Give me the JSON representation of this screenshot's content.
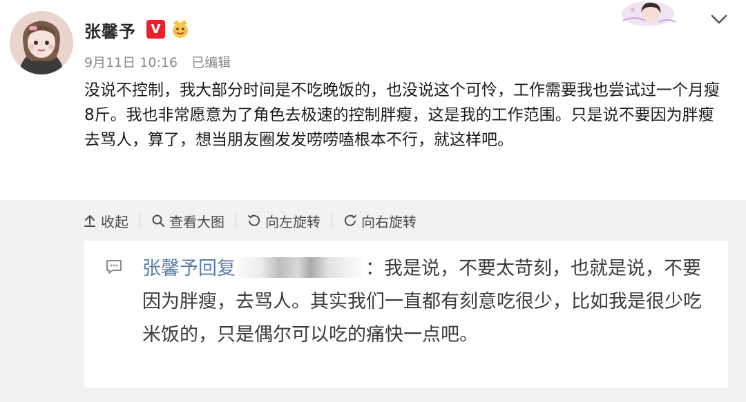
{
  "post": {
    "username": "张馨予",
    "badge_v": "V",
    "date": "9月11日 10:16",
    "edited": "已编辑",
    "content": "没说不控制，我大部分时间是不吃晚饭的，也没说这个可怜，工作需要我也尝试过一个月瘦8斤。我也非常愿意为了角色去极速的控制胖瘦，这是我的工作范围。只是说不要因为胖瘦去骂人，算了，想当朋友圈发发唠唠嗑根本不行，就这样吧。"
  },
  "toolbar": {
    "collapse": "收起",
    "view_large": "查看大图",
    "rotate_left": "向左旋转",
    "rotate_right": "向右旋转"
  },
  "reply": {
    "user": "张馨予",
    "action": "回复",
    "text": "：我是说，不要太苛刻，也就是说，不要因为胖瘦，去骂人。其实我们一直都有刻意吃很少，比如我是很少吃米饭的，只是偶尔可以吃的痛快一点吧。"
  },
  "icons": {
    "avatar": "avatar-illustration",
    "verified": "verified-v-icon",
    "crown": "crown-face-icon",
    "more": "chevron-down-icon",
    "collapse": "arrow-up-icon",
    "view": "search-icon",
    "rotate_left": "rotate-left-icon",
    "rotate_right": "rotate-right-icon",
    "comment": "comment-bubble-icon"
  },
  "colors": {
    "verified_red": "#e8212b",
    "link_blue": "#5a7da8",
    "meta_gray": "#8a8a8a",
    "panel_gray": "#f2f2f5"
  }
}
